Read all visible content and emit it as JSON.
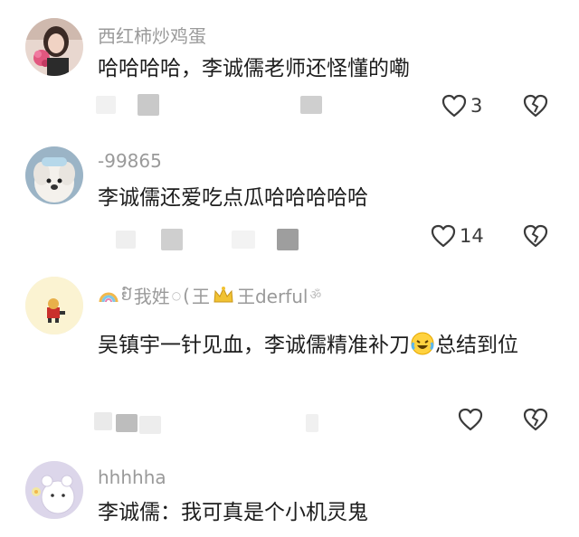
{
  "comments": [
    {
      "username": "西红柿炒鸡蛋",
      "text": "哈哈哈哈，李诚儒老师还怪懂的嘞",
      "likes": "3",
      "avatar": "woman-with-flowers-avatar"
    },
    {
      "username": "-99865",
      "text": "李诚儒还爱吃点瓜哈哈哈哈哈",
      "likes": "14",
      "avatar": "white-dog-avatar"
    },
    {
      "username_parts": [
        "我姓",
        "王",
        "王derful"
      ],
      "text_before_emoji": "吴镇宇一针见血，李诚儒精准补刀",
      "text_after_emoji": "总结到位",
      "likes": "",
      "avatar": "cartoon-character-avatar",
      "emoji": "crying-laughing-emoji"
    },
    {
      "username": "hhhhha",
      "text": "李诚儒：我可真是个小机灵鬼",
      "avatar": "white-bear-cartoon-avatar"
    }
  ],
  "colors": {
    "text": "#1d1d1d",
    "username": "#9a9a9a",
    "icon": "#3a3a3a"
  }
}
